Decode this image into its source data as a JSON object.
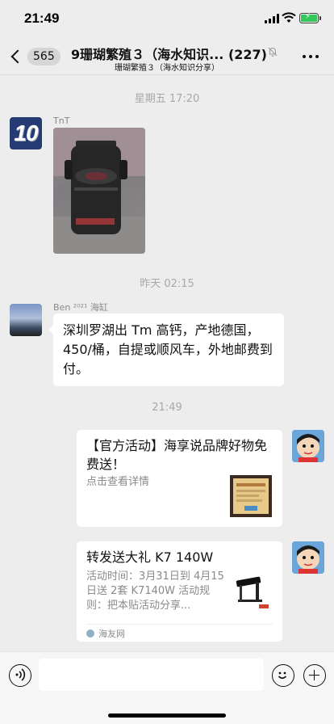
{
  "status": {
    "time": "21:49"
  },
  "nav": {
    "unread_count": "565",
    "title": "9珊瑚繁殖３（海水知识...  (227)",
    "subtitle": "珊瑚繁殖３（海水知识分享）"
  },
  "chat": {
    "timestamp_1": "星期五 17:20",
    "msg1": {
      "sender": "TnT",
      "avatar_text": "10"
    },
    "timestamp_2": "昨天 02:15",
    "msg2": {
      "sender": "Ben ²⁰²¹ 海缸",
      "text": "深圳罗湖出 Tm 高钙，产地德国，450/桶，自提或顺风车，外地邮费到付。"
    },
    "timestamp_3": "21:49",
    "card1": {
      "title": "【官方活动】海享说品牌好物免费送！",
      "desc": "点击查看详情"
    },
    "card2": {
      "title": "转发送大礼 K7 140W",
      "desc": "活动时间：3月31日到 4月15日送 2套 K7140W 活动规则：把本贴活动分享...",
      "source": "海友网"
    }
  },
  "colors": {
    "background": "#ededed",
    "bubble": "#ffffff",
    "battery": "#34c759",
    "muted_text": "#a8a8a8"
  }
}
